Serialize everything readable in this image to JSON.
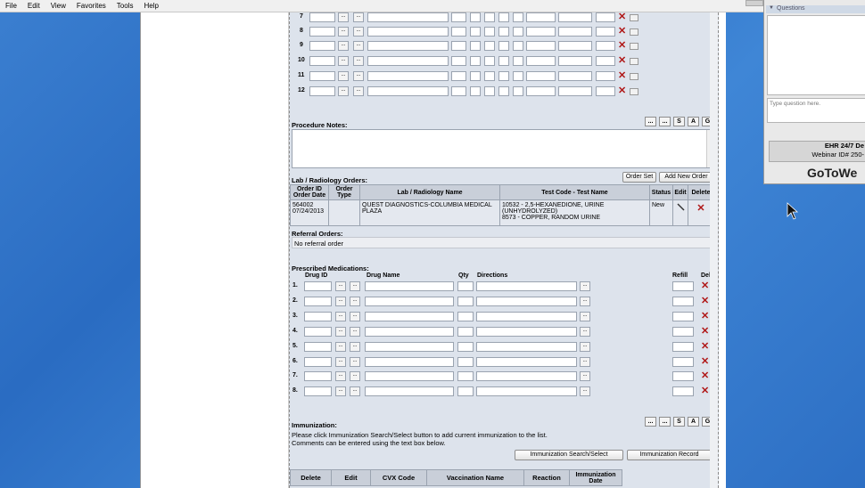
{
  "menu": [
    "File",
    "Edit",
    "View",
    "Favorites",
    "Tools",
    "Help"
  ],
  "procedure_rows": [
    "7",
    "8",
    "9",
    "10",
    "11",
    "12"
  ],
  "procedure_notes": {
    "label": "Procedure Notes:",
    "buttons": [
      "...",
      "...",
      "S",
      "A",
      "G"
    ]
  },
  "lab_orders": {
    "label": "Lab / Radiology Orders:",
    "order_set": "Order Set",
    "add_new": "Add New Order",
    "headers": [
      "Order ID Order Date",
      "Order Type",
      "Lab / Radiology Name",
      "Test Code - Test Name",
      "Status",
      "Edit",
      "Delete"
    ],
    "row": {
      "order_id": "564002",
      "order_date": "07/24/2013",
      "order_type": "",
      "lab_name": "QUEST DIAGNOSTICS-COLUMBIA MEDICAL PLAZA",
      "test_1": "10532 - 2,5-HEXANEDIONE, URINE (UNHYDROLYZED)",
      "test_2": "8573 - COPPER, RANDOM URINE",
      "status": "New"
    }
  },
  "referral": {
    "label": "Referral Orders:",
    "value": "No referral order"
  },
  "meds": {
    "label": "Prescribed Medications:",
    "col_drug_id": "Drug ID",
    "col_drug_name": "Drug Name",
    "col_qty": "Qty",
    "col_directions": "Directions",
    "col_refill": "Refill",
    "col_del": "Del",
    "rows": [
      "1.",
      "2.",
      "3.",
      "4.",
      "5.",
      "6.",
      "7.",
      "8."
    ]
  },
  "immunization": {
    "label": "Immunization:",
    "buttons": [
      "...",
      "...",
      "S",
      "A",
      "G"
    ],
    "note_1": "Please click Immunization Search/Select button to add current immunization to the list.",
    "note_2": "Comments can be entered using the text box below.",
    "search_btn": "Immunization Search/Select",
    "record_btn": "Immunization Record",
    "headers": [
      "Delete",
      "Edit",
      "CVX Code",
      "Vaccination Name",
      "Reaction",
      "Immunization Date"
    ]
  },
  "gotowebinar": {
    "panel_title": "Questions",
    "type_placeholder": "Type question here.",
    "info_line_1": "EHR 24/7 De",
    "info_line_2": "Webinar ID# 250-",
    "logo": "GoToWe"
  },
  "colors": {
    "delete_x": "#b01717",
    "desktop": "#3b7fd0",
    "form_bg": "#dde3ec"
  }
}
